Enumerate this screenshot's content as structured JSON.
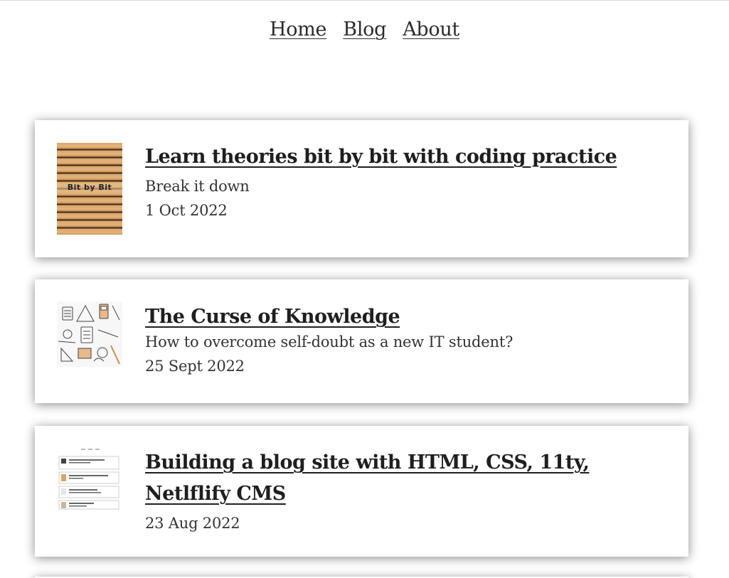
{
  "nav": {
    "items": [
      {
        "label": "Home"
      },
      {
        "label": "Blog"
      },
      {
        "label": "About"
      }
    ]
  },
  "posts": [
    {
      "title": "Learn theories bit by bit with coding practice",
      "description": "Break it down",
      "date": "1 Oct 2022",
      "thumbnail_text": "Bit by Bit"
    },
    {
      "title": "The Curse of Knowledge",
      "description": "How to overcome self-doubt as a new IT student?",
      "date": "25 Sept 2022"
    },
    {
      "title": "Building a blog site with HTML, CSS, 11ty, Netlflify CMS",
      "date": "23 Aug 2022"
    }
  ]
}
